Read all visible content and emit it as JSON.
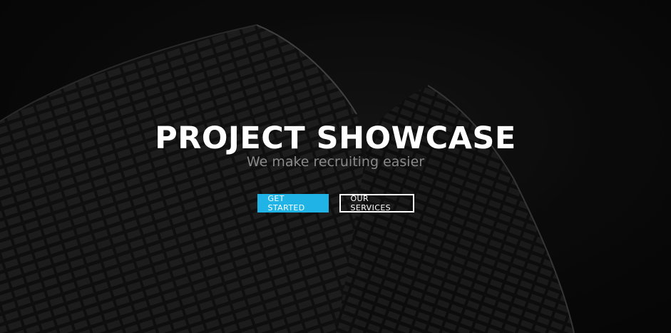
{
  "hero": {
    "title": "PROJECT SHOWCASE",
    "subtitle": "We make recruiting easier",
    "background_icon": "building-facade-image"
  },
  "actions": {
    "primary_label": "GET STARTED",
    "secondary_label": "OUR SERVICES"
  },
  "colors": {
    "accent": "#1fb3e6",
    "background": "#0b0b0b",
    "title": "#ffffff",
    "subtitle": "#8a8a8a"
  }
}
